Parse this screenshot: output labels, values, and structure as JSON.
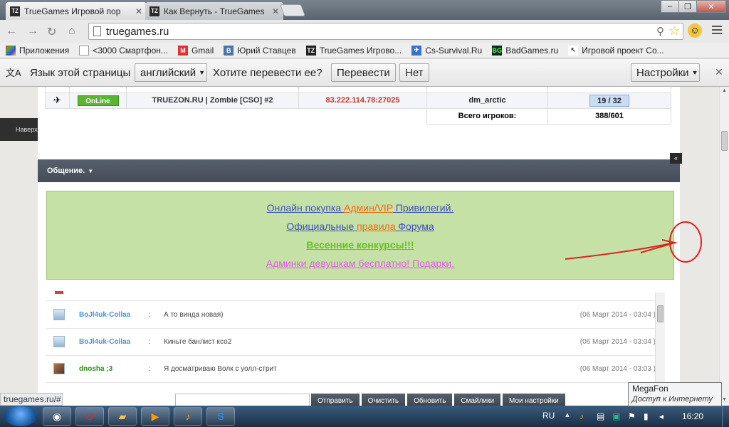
{
  "browser": {
    "tabs": [
      {
        "favicon": "TZ",
        "title": "TrueGames Игровой пор"
      },
      {
        "favicon": "TZ",
        "title": "Как Вернуть - TrueGames"
      }
    ],
    "url": "truegames.ru",
    "bookmarks": [
      {
        "label": "Приложения",
        "icon": "apps-grid-icon"
      },
      {
        "label": "<3000 Смартфон...",
        "icon": "page-icon"
      },
      {
        "label": "Gmail",
        "icon": "gmail-icon"
      },
      {
        "label": "Юрий Ставцев",
        "icon": "vk-icon"
      },
      {
        "label": "TrueGames Игрово...",
        "icon": "tz-icon"
      },
      {
        "label": "Cs-Survival.Ru",
        "icon": "cs-icon"
      },
      {
        "label": "BadGames.ru",
        "icon": "bg-icon"
      },
      {
        "label": "Игровой проект Co...",
        "icon": "arrow-icon"
      }
    ],
    "translate": {
      "prompt": "Язык этой страницы",
      "language": "английский",
      "question": "Хотите перевести ее?",
      "translate_btn": "Перевести",
      "no_btn": "Нет",
      "settings_btn": "Настройки"
    },
    "status_url": "truegames.ru/#"
  },
  "page": {
    "back_to_top": "Наверх",
    "servers": [
      {
        "status": "OnLine",
        "name": "TRUEZON.RU | Zombie [CSO] #2",
        "ip": "83.222.114.78:27025",
        "map": "dm_arctic",
        "players": "19 / 32"
      }
    ],
    "total_label": "Всего игроков:",
    "total_value": "388/601",
    "chat_title": "Общение.",
    "collapse": "«",
    "notice": {
      "line1_a": "Онлайн покупка ",
      "line1_b": "Админ/VIP",
      "line1_c": " Привилегий.",
      "line2_a": "Официальные ",
      "line2_b": "правила",
      "line2_c": " Форума",
      "line3": "Весенние конкурсы!!!",
      "line4": "Админки девушкам бесплатно! Подарки."
    },
    "chat": [
      {
        "nick": "BoJl4uk-Collaa",
        "nick_color": "#4a90d9",
        "sep": ":",
        "message": "А то винда новая)",
        "date": "(06 Март 2014 - 03:04 )",
        "avatar": "default"
      },
      {
        "nick": "BoJl4uk-Collaa",
        "nick_color": "#4a90d9",
        "sep": ":",
        "message": "Киньте банлист ксо2",
        "date": "(06 Март 2014 - 03:04 )",
        "avatar": "default"
      },
      {
        "nick": "dnosha ;3",
        "nick_color": "#2e8b1a",
        "sep": ":",
        "message": "Я досматриваю Волк с уолл-стрит",
        "date": "(06 Март 2014 - 03:03 )",
        "avatar": "photo"
      }
    ],
    "chat_buttons": [
      "Отправить",
      "Очистить",
      "Обновить",
      "Смайлики",
      "Мои настройки"
    ]
  },
  "taskbar": {
    "lang": "RU",
    "clock": "16:20",
    "tooltip_title": "MegaFon",
    "tooltip_sub": "Доступ к Интернету"
  },
  "colors": {
    "annotation": "#e02020",
    "header": "#4a535e",
    "notice_bg": "#c6e1a6"
  }
}
